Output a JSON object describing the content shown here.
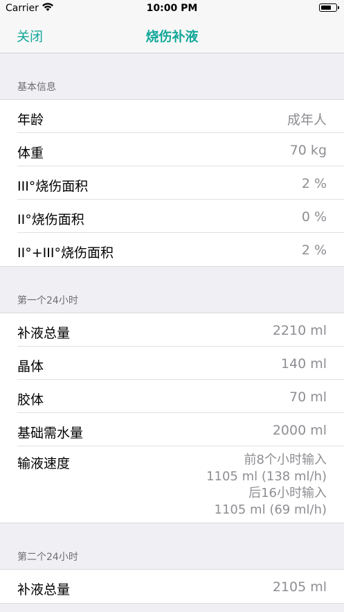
{
  "status": {
    "carrier": "Carrier",
    "time": "10:00 PM"
  },
  "nav": {
    "close_label": "关闭",
    "title": "烧伤补液"
  },
  "sections": {
    "basic": {
      "header": "基本信息",
      "rows": [
        {
          "label": "年龄",
          "value": "成年人"
        },
        {
          "label": "体重",
          "value": "70 kg"
        },
        {
          "label": "III°烧伤面积",
          "value": "2 %"
        },
        {
          "label": "II°烧伤面积",
          "value": "0 %"
        },
        {
          "label": "II°+III°烧伤面积",
          "value": "2 %"
        }
      ]
    },
    "first24": {
      "header": "第一个24小时",
      "rows": [
        {
          "label": "补液总量",
          "value": "2210 ml"
        },
        {
          "label": "晶体",
          "value": "140 ml"
        },
        {
          "label": "胶体",
          "value": "70 ml"
        },
        {
          "label": "基础需水量",
          "value": "2000 ml"
        }
      ],
      "rate": {
        "label": "输液速度",
        "lines": [
          "前8个小时输入",
          "1105 ml (138 ml/h)",
          "后16小时输入",
          "1105 ml (69 ml/h)"
        ]
      }
    },
    "second24": {
      "header": "第二个24小时",
      "rows": [
        {
          "label": "补液总量",
          "value": "2105 ml"
        }
      ]
    }
  }
}
